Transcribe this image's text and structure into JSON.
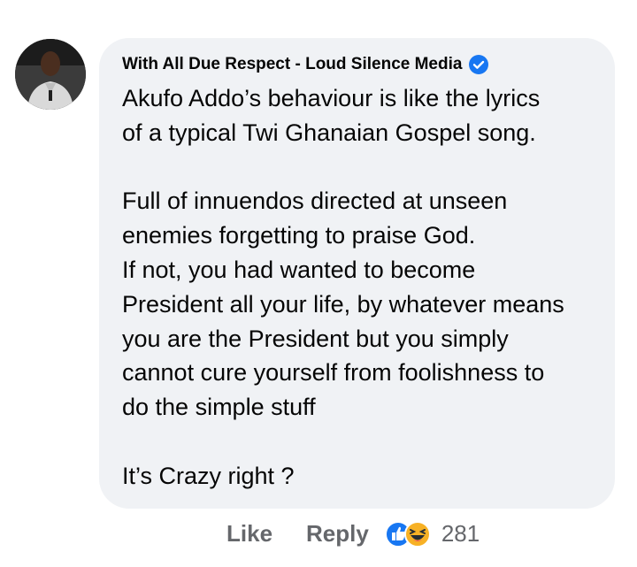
{
  "comment": {
    "author": "With All Due Respect - Loud Silence Media",
    "author_verified_icon": "verified-badge-icon",
    "paragraphs": [
      [
        "Akufo Addo’s behaviour is like the lyrics",
        "of a typical Twi Ghanaian Gospel song."
      ],
      [
        "Full of innuendos directed at unseen",
        "enemies forgetting to praise God.",
        "If not, you had wanted to become",
        "President all your life, by whatever means",
        "you are the President but you simply",
        "cannot cure yourself from foolishness to",
        "do the simple stuff"
      ],
      [
        "It’s Crazy right ?"
      ]
    ]
  },
  "actions": {
    "like_label": "Like",
    "reply_label": "Reply",
    "reaction_icons": [
      "like-reaction-icon",
      "haha-reaction-icon"
    ],
    "reaction_count": "281"
  },
  "colors": {
    "bubble": "#f0f2f5",
    "text": "#050505",
    "secondary": "#65676b",
    "accent": "#1877f2"
  }
}
